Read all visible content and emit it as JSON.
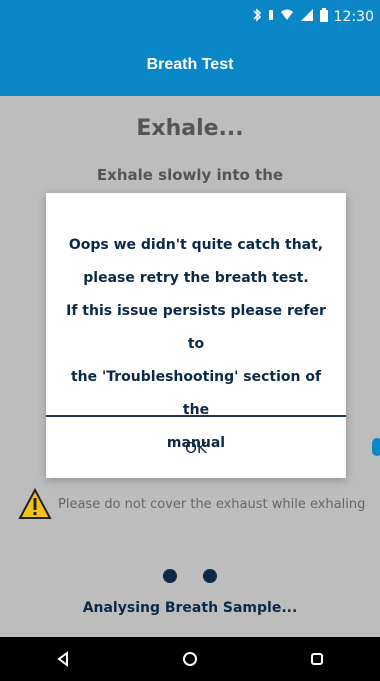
{
  "status_bar": {
    "time": "12:30",
    "icons": [
      "bluetooth-icon",
      "vibrate-icon",
      "wifi-icon",
      "signal-icon",
      "battery-icon"
    ]
  },
  "app_bar": {
    "title": "Breath Test"
  },
  "screen": {
    "heading": "Exhale...",
    "instruction": "Exhale slowly into the",
    "warning_text": "Please do not cover the exhaust while exhaling",
    "status_text": "Analysing Breath Sample..."
  },
  "dialog": {
    "message_lines": [
      "Oops we didn't quite catch that,",
      "please retry the breath test.",
      "If this issue persists please refer to",
      "the 'Troubleshooting' section of the",
      "manual"
    ],
    "ok_label": "OK"
  },
  "colors": {
    "primary": "#0b87c8",
    "text_dark": "#0b2a49",
    "overlay_gray": "#bdbdbd"
  }
}
